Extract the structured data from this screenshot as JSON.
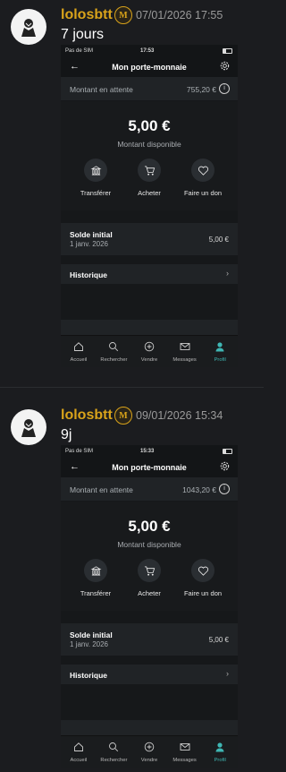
{
  "posts": [
    {
      "username": "lolosbtt",
      "badge": "M",
      "date": "07/01/2026 17:55",
      "caption": "7 jours",
      "phone": {
        "carrier": "Pas de SIM",
        "time": "17:53",
        "title": "Mon porte-monnaie",
        "pending_label": "Montant en attente",
        "pending_amount": "755,20 €",
        "balance": "5,00 €",
        "balance_label": "Montant disponible",
        "actions": [
          "Transférer",
          "Acheter",
          "Faire un don"
        ],
        "initial_title": "Solde initial",
        "initial_date": "1 janv. 2026",
        "initial_amount": "5,00 €",
        "history": "Historique",
        "tabs": [
          "Accueil",
          "Rechercher",
          "Vendre",
          "Messages",
          "Profil"
        ]
      }
    },
    {
      "username": "lolosbtt",
      "badge": "M",
      "date": "09/01/2026 15:34",
      "caption": "9j",
      "phone": {
        "carrier": "Pas de SIM",
        "time": "15:33",
        "title": "Mon porte-monnaie",
        "pending_label": "Montant en attente",
        "pending_amount": "1043,20 €",
        "balance": "5,00 €",
        "balance_label": "Montant disponible",
        "actions": [
          "Transférer",
          "Acheter",
          "Faire un don"
        ],
        "initial_title": "Solde initial",
        "initial_date": "1 janv. 2026",
        "initial_amount": "5,00 €",
        "history": "Historique",
        "tabs": [
          "Accueil",
          "Rechercher",
          "Vendre",
          "Messages",
          "Profil"
        ]
      }
    }
  ],
  "colors": {
    "username": "#d9a31a",
    "active_tab": "#3fb7b4",
    "background": "#1b1c1f"
  },
  "icons": [
    "bank-icon",
    "cart-icon",
    "heart-donate-icon",
    "home-icon",
    "search-icon",
    "plus-circle-icon",
    "mail-icon",
    "profile-icon",
    "gear-icon",
    "info-icon",
    "back-arrow-icon",
    "chevron-right-icon"
  ]
}
